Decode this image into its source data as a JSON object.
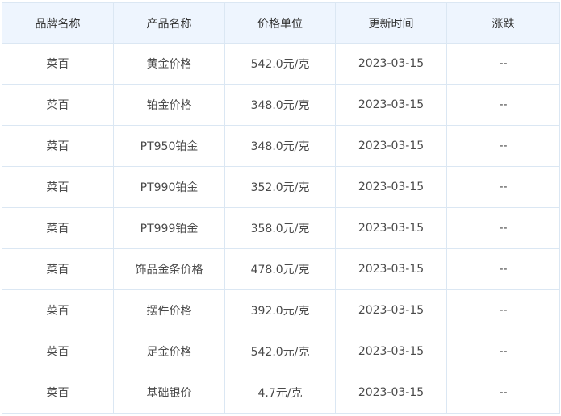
{
  "table": {
    "columns": [
      "品牌名称",
      "产品名称",
      "价格单位",
      "更新时间",
      "涨跌"
    ],
    "rows": [
      [
        "菜百",
        "黄金价格",
        "542.0元/克",
        "2023-03-15",
        "--"
      ],
      [
        "菜百",
        "铂金价格",
        "348.0元/克",
        "2023-03-15",
        "--"
      ],
      [
        "菜百",
        "PT950铂金",
        "348.0元/克",
        "2023-03-15",
        "--"
      ],
      [
        "菜百",
        "PT990铂金",
        "352.0元/克",
        "2023-03-15",
        "--"
      ],
      [
        "菜百",
        "PT999铂金",
        "358.0元/克",
        "2023-03-15",
        "--"
      ],
      [
        "菜百",
        "饰品金条价格",
        "478.0元/克",
        "2023-03-15",
        "--"
      ],
      [
        "菜百",
        "摆件价格",
        "392.0元/克",
        "2023-03-15",
        "--"
      ],
      [
        "菜百",
        "足金价格",
        "542.0元/克",
        "2023-03-15",
        "--"
      ],
      [
        "菜百",
        "基础银价",
        "4.7元/克",
        "2023-03-15",
        "--"
      ]
    ]
  },
  "colors": {
    "header_bg": "#eef5fe",
    "border": "#dbe7f3",
    "text": "#4a4a4a"
  }
}
